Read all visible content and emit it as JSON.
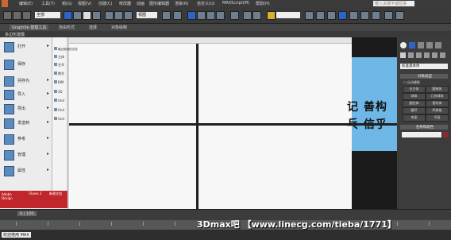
{
  "menubar": {
    "items": [
      "编辑(E)",
      "工具(T)",
      "组(G)",
      "视图(V)",
      "创建(C)",
      "修改器",
      "动画",
      "图形编辑器",
      "渲染(R)",
      "自定义(U)",
      "MAXScript(M)",
      "帮助(H)"
    ],
    "search_placeholder": "键入关键字或短语"
  },
  "toolbar": {
    "selection_set": "全部",
    "view_mode": "视图"
  },
  "ribbon": {
    "title": "Graphite 建模工具",
    "tabs": [
      "自由形式",
      "选择",
      "对象绘制"
    ],
    "sub_label": "多边形建模"
  },
  "file_menu": {
    "items": [
      {
        "label": "打开",
        "arrow": "▸"
      },
      {
        "label": "保存",
        "arrow": ""
      },
      {
        "label": "另存为",
        "arrow": "▸"
      },
      {
        "label": "导入",
        "arrow": "▸"
      },
      {
        "label": "导出",
        "arrow": "▸"
      },
      {
        "label": "发送到",
        "arrow": "▸"
      },
      {
        "label": "参考",
        "arrow": "▸"
      },
      {
        "label": "管理",
        "arrow": "▸"
      },
      {
        "label": "属性",
        "arrow": "▸"
      }
    ],
    "recent_header": "最近使用的文档",
    "recent": [
      "立体",
      "艺术",
      "数学",
      "BIM",
      "3D",
      "Und",
      "Und",
      "Und"
    ],
    "thumb_text": "Adobe Design",
    "thumb_text2": "iTunes 3",
    "thumb_text3": "新建文档"
  },
  "viewport": {
    "chinese_text_1": "记 善构",
    "chinese_text_2": "乓 信乎"
  },
  "command_panel": {
    "dropdown": "标准基本体",
    "section_object_type": "对象类型",
    "autogrid": "自动栅格",
    "buttons": [
      "长方体",
      "圆锥体",
      "球体",
      "几何球体",
      "圆柱体",
      "管状体",
      "圆环",
      "四棱锥",
      "茶壶",
      "平面"
    ],
    "section_name_color": "名称和颜色"
  },
  "timeline": {
    "frame": "0 / 100"
  },
  "watermark": "3Dmax吧 【www.linecg.com/tieba/1771】",
  "status": {
    "welcome": "欢迎使用 MAX"
  }
}
